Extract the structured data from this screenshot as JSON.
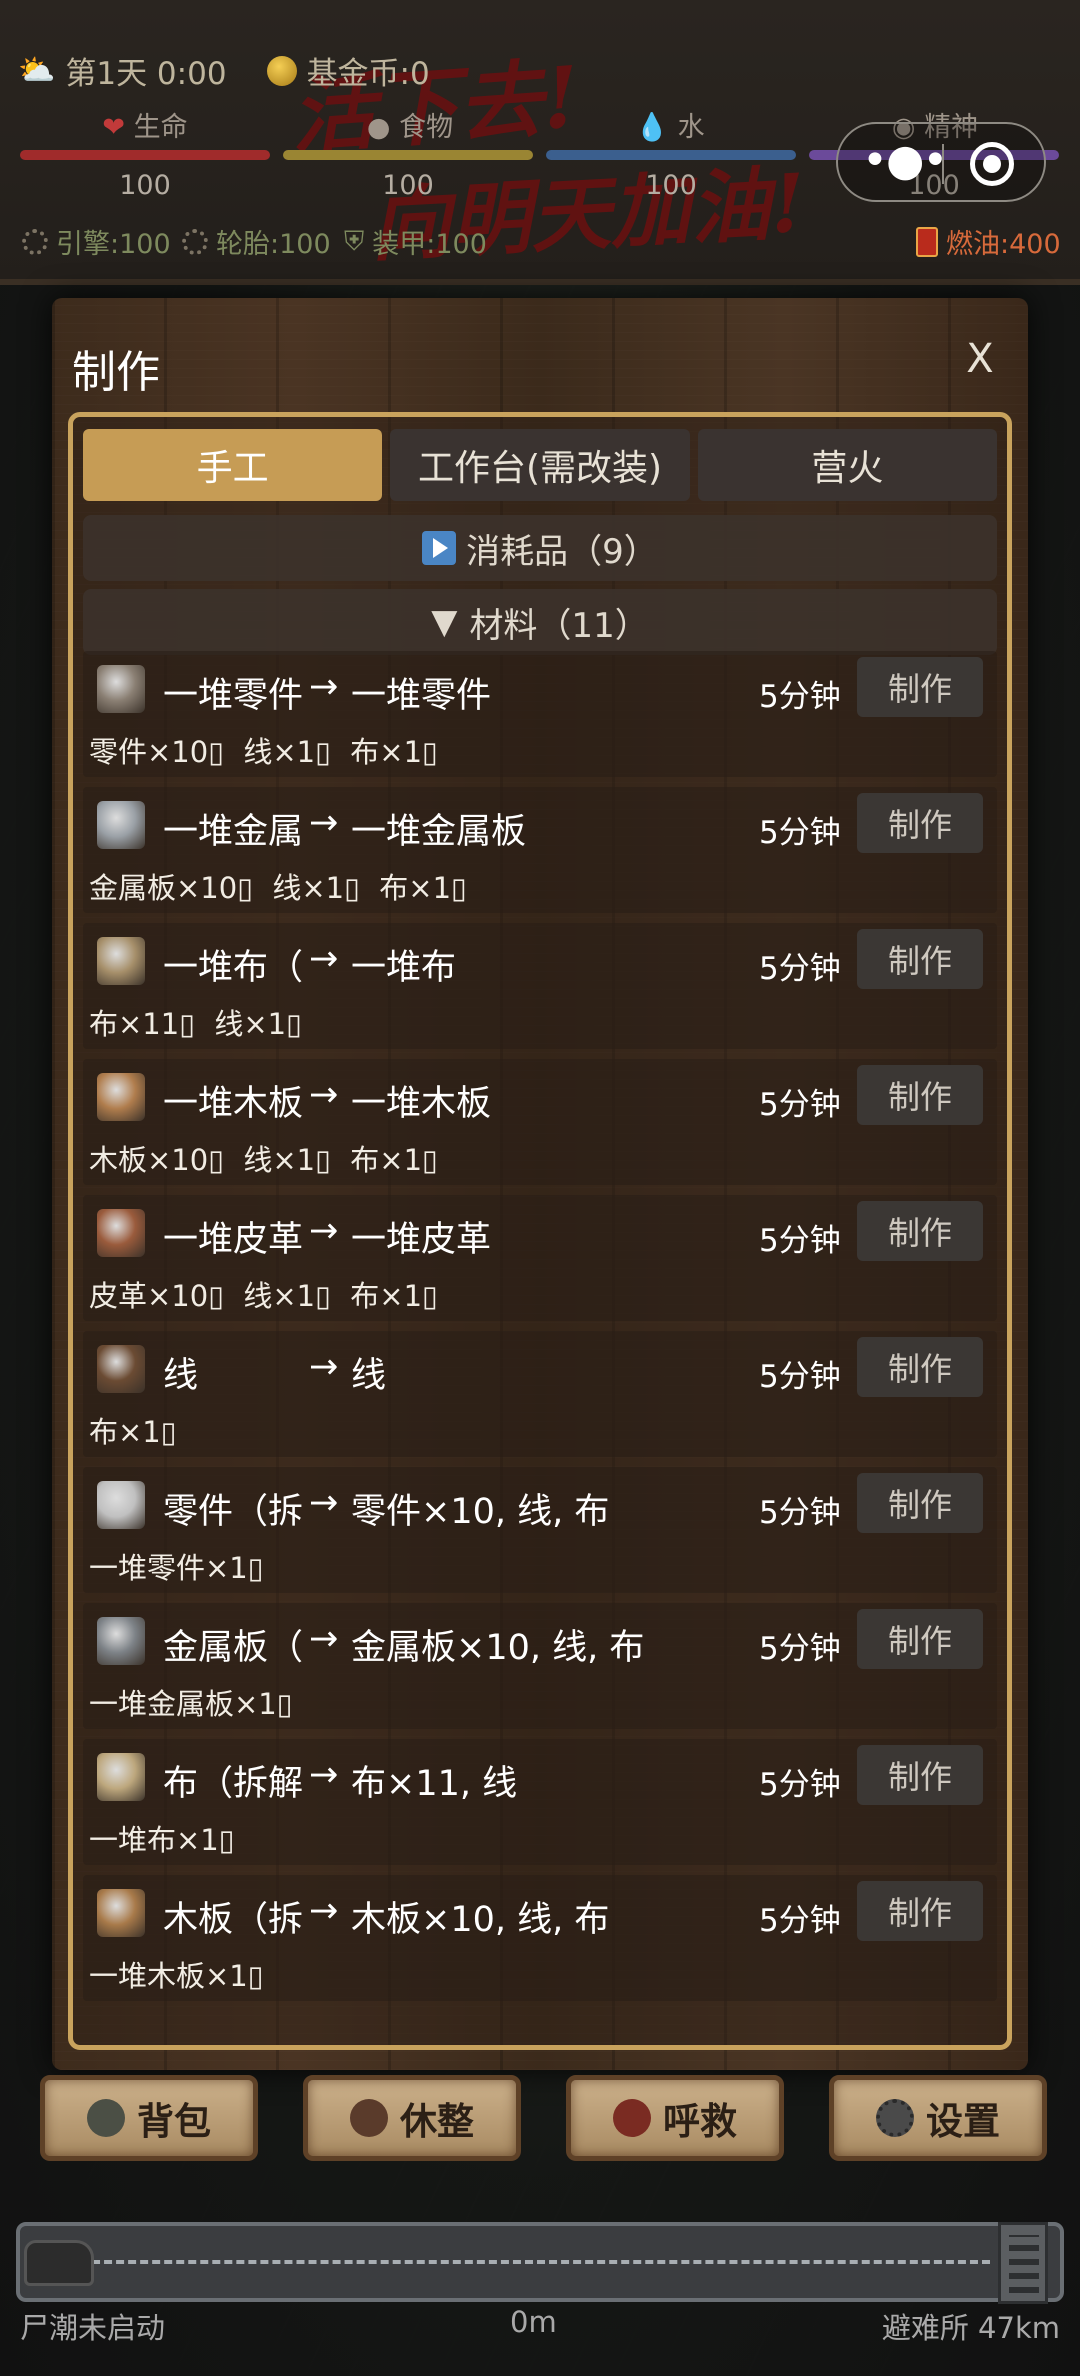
{
  "status": {
    "day": "第1天 0:00",
    "fund": "基金币:0",
    "graffiti": [
      "活下去!",
      "向明天加油!"
    ],
    "stats": [
      {
        "label": "生命",
        "value": "100",
        "color": "#a02b2b",
        "icon": "heart-icon"
      },
      {
        "label": "食物",
        "value": "100",
        "color": "#9a8533",
        "icon": "food-icon"
      },
      {
        "label": "水",
        "value": "100",
        "color": "#3b5f8e",
        "icon": "water-drop-icon"
      },
      {
        "label": "精神",
        "value": "100",
        "color": "#6b4a9a",
        "icon": "mind-icon"
      }
    ],
    "vehicle": {
      "engine": "引擎:100",
      "tires": "轮胎:100",
      "armor": "装甲:100",
      "fuel": "燃油:400"
    }
  },
  "dialog": {
    "title": "制作",
    "close": "X",
    "tabs": [
      "手工",
      "工作台(需改装)",
      "营火"
    ],
    "active_tab": 0,
    "categories": [
      {
        "label": "消耗品（9）",
        "expanded": false
      },
      {
        "label": "材料（11）",
        "expanded": true
      }
    ],
    "button_label": "制作",
    "items": [
      {
        "name": "一堆零件",
        "output": "一堆零件",
        "time": "5分钟",
        "req": "零件×10▯ 线×1▯ 布×1▯",
        "icon": "parts-pile-icon"
      },
      {
        "name": "一堆金属",
        "output": "一堆金属板",
        "time": "5分钟",
        "req": "金属板×10▯ 线×1▯ 布×1▯",
        "icon": "metal-stack-icon"
      },
      {
        "name": "一堆布（",
        "output": "一堆布",
        "time": "5分钟",
        "req": "布×11▯ 线×1▯",
        "icon": "cloth-pile-icon"
      },
      {
        "name": "一堆木板",
        "output": "一堆木板",
        "time": "5分钟",
        "req": "木板×10▯ 线×1▯ 布×1▯",
        "icon": "planks-icon"
      },
      {
        "name": "一堆皮革",
        "output": "一堆皮革",
        "time": "5分钟",
        "req": "皮革×10▯ 线×1▯ 布×1▯",
        "icon": "leather-icon"
      },
      {
        "name": "线",
        "output": "线",
        "time": "5分钟",
        "req": "布×1▯",
        "icon": "thread-spool-icon"
      },
      {
        "name": "零件（拆",
        "output": "零件×10, 线, 布",
        "time": "5分钟",
        "req": "一堆零件×1▯",
        "icon": "bolt-icon"
      },
      {
        "name": "金属板（",
        "output": "金属板×10, 线, 布",
        "time": "5分钟",
        "req": "一堆金属板×1▯",
        "icon": "metal-plate-icon"
      },
      {
        "name": "布（拆解",
        "output": "布×11, 线",
        "time": "5分钟",
        "req": "一堆布×1▯",
        "icon": "cloth-roll-icon"
      },
      {
        "name": "木板（拆",
        "output": "木板×10, 线, 布",
        "time": "5分钟",
        "req": "一堆木板×1▯",
        "icon": "plank-icon"
      }
    ]
  },
  "bottom_buttons": [
    {
      "label": "背包",
      "icon": "backpack-icon"
    },
    {
      "label": "休整",
      "icon": "rest-icon"
    },
    {
      "label": "呼救",
      "icon": "sos-icon"
    },
    {
      "label": "设置",
      "icon": "gear-icon"
    }
  ],
  "progress": {
    "left": "尸潮未启动",
    "center": "0m",
    "right": "避难所 47km"
  }
}
